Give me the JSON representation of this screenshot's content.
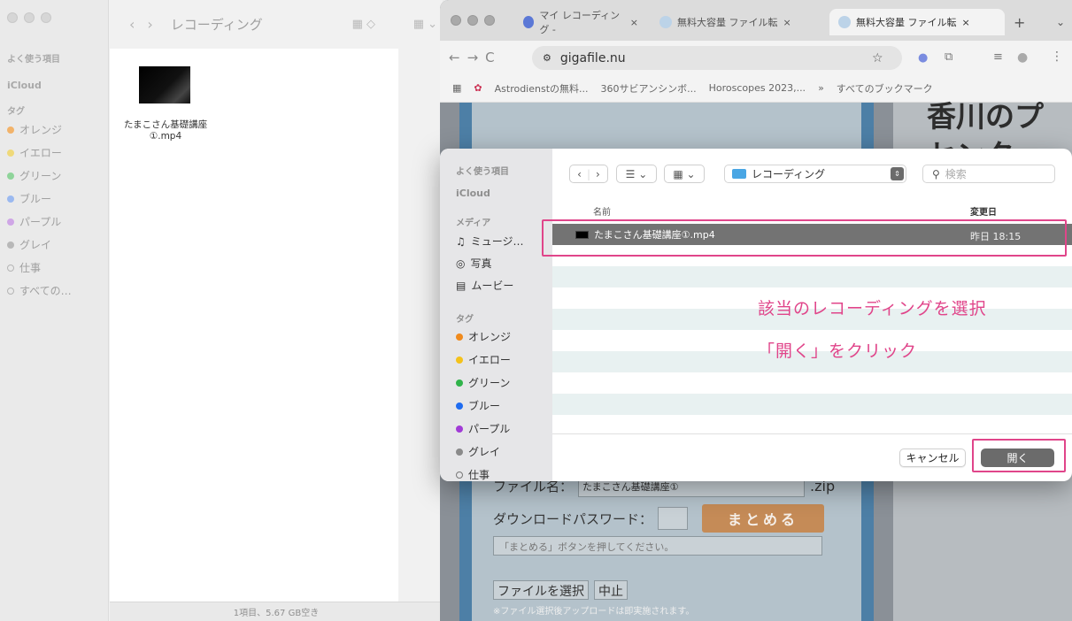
{
  "finder": {
    "title": "レコーディング",
    "sidebar": {
      "favorites_label": "よく使う項目",
      "icloud_label": "iCloud",
      "tags_label": "タグ",
      "tags": [
        {
          "label": "オレンジ",
          "color": "#f2b36a"
        },
        {
          "label": "イエロー",
          "color": "#efd97a"
        },
        {
          "label": "グリーン",
          "color": "#8fd49a"
        },
        {
          "label": "ブルー",
          "color": "#9bb9f0"
        },
        {
          "label": "パープル",
          "color": "#cfa6e6"
        },
        {
          "label": "グレイ",
          "color": "#b8b8b8"
        },
        {
          "label": "仕事",
          "color": "none"
        },
        {
          "label": "すべての…",
          "color": "none"
        }
      ]
    },
    "file": {
      "name_line1": "たまこさん基礎講座",
      "name_line2": "①.mp4"
    },
    "status": "1項目、5.67 GB空き"
  },
  "browser": {
    "tabs": [
      {
        "label": "マイ レコーディング -"
      },
      {
        "label": "無料大容量 ファイル転"
      },
      {
        "label": "無料大容量 ファイル転"
      }
    ],
    "new_tab": "+",
    "url": "gigafile.nu",
    "bookmarks": [
      "Astrodienstの無料...",
      "360サビアンシンボ...",
      "Horoscopes 2023,...",
      "»",
      "すべてのブックマーク"
    ],
    "page": {
      "right_text_1": "香川のプ",
      "right_text_2": "センター",
      "filename_label": "ファイル名：",
      "filename_value": "たまこさん基礎講座①",
      "filename_ext": ".zip",
      "password_label": "ダウンロードパスワード：",
      "combine_button": "まとめる",
      "hint": "「まとめる」ボタンを押してください。",
      "select_button": "ファイルを選択",
      "cancel_button": "中止",
      "note": "※ファイル選択後アップロードは即実施されます。"
    }
  },
  "dialog": {
    "sidebar": {
      "favorites_label": "よく使う項目",
      "icloud_label": "iCloud",
      "media_label": "メディア",
      "media": [
        "ミュージ…",
        "写真",
        "ムービー"
      ],
      "tags_label": "タグ",
      "tags": [
        {
          "label": "オレンジ",
          "color": "#f08a1c"
        },
        {
          "label": "イエロー",
          "color": "#f4c21b"
        },
        {
          "label": "グリーン",
          "color": "#30b34a"
        },
        {
          "label": "ブルー",
          "color": "#1f6cf0"
        },
        {
          "label": "パープル",
          "color": "#a13bd6"
        },
        {
          "label": "グレイ",
          "color": "#8a8a8a"
        },
        {
          "label": "仕事",
          "color": "none"
        }
      ]
    },
    "location": "レコーディング",
    "search_placeholder": "検索",
    "columns": {
      "name": "名前",
      "modified": "変更日"
    },
    "row": {
      "name": "たまこさん基礎講座①.mp4",
      "date": "昨日 18:15"
    },
    "annotation_1": "該当のレコーディングを選択",
    "annotation_2": "「開く」をクリック",
    "cancel_label": "キャンセル",
    "open_label": "開く",
    "annotation_color": "#e0458a"
  }
}
